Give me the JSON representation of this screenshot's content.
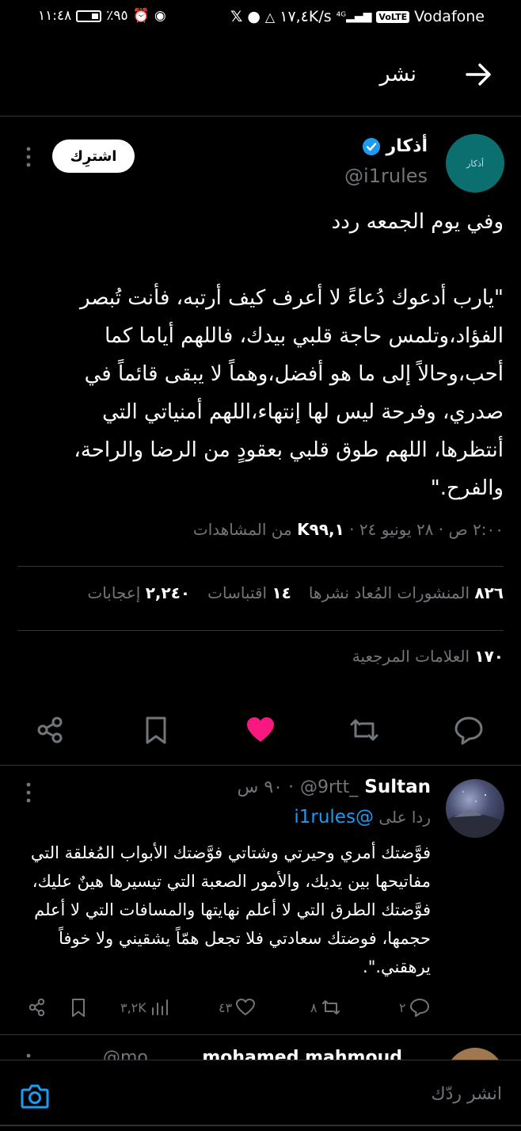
{
  "status_bar": {
    "time": "١١:٤٨",
    "battery": "٪٩٥",
    "speed": "١٧,٤K/s",
    "carrier": "Vodafone",
    "volte": "VoLTE",
    "network": "4G"
  },
  "header": {
    "title": "نشر"
  },
  "tweet": {
    "author_name": "أذكار",
    "handle": "@i1rules",
    "avatar_text": "أذكار",
    "subscribe_label": "اشترِك",
    "body": "وفي يوم الجمعه ردد\n\n\"يارب أدعوك دُعاءً لا أعرف كيف أرتبه، فأنت تُبصر الفؤاد،وتلمس حاجة قلبي بيدك، فاللهم أياما كما أحب،وحالاً إلى ما هو أفضل،وهماً لا يبقى قائماً في صدري، وفرحة ليس لها إنتهاء،اللهم أمنياتي التي أنتظرها، اللهم طوق قلبي بعقودٍ من الرضا والراحة، والفرح.\"",
    "meta_time": "٢:٠٠ ص · ٢٨ يونيو ٢٤ · ",
    "meta_views": "K٩٩,١",
    "meta_views_label": " من المشاهدات",
    "reposts_count": "٨٢٦",
    "reposts_label": "المنشورات المُعاد نشرها",
    "quotes_count": "١٤",
    "quotes_label": "اقتباسات",
    "likes_count": "٢,٢٤٠",
    "likes_label": "إعجابات",
    "bookmarks_count": "١٧٠",
    "bookmarks_label": "العلامات المرجعية",
    "like_color": "#f91880"
  },
  "reply": {
    "name": "Sultan",
    "handle": "@9rtt_",
    "time": "٩٠ س ·",
    "replying_label": "ردا على",
    "replying_handle": "@i1rules",
    "body": "فوَّضتك أمري وحيرتي وشتاتي فوَّضتك الأبواب المُغلقة التي مفاتيحها بين يديك، والأمور الصعبة التي تيسيرها هينٌ عليك، فوَّضتك الطرق التي لا أعلم نهايتها والمسافات التي لا أعلم حجمها، فوضتك سعادتي فلا تجعل همّاً يشقيني ولا خوفاً يرهقني.\".",
    "replies": "٢",
    "reposts": "٨",
    "likes": "٤٣",
    "views": "٣,٢K"
  },
  "next_reply": {
    "name": "mohamed mahmoud",
    "handle": "@mo..."
  },
  "composer": {
    "placeholder": "انشر ردّك"
  },
  "colors": {
    "accent": "#1d9bf0",
    "muted": "#71767b",
    "divider": "#2f3336"
  }
}
